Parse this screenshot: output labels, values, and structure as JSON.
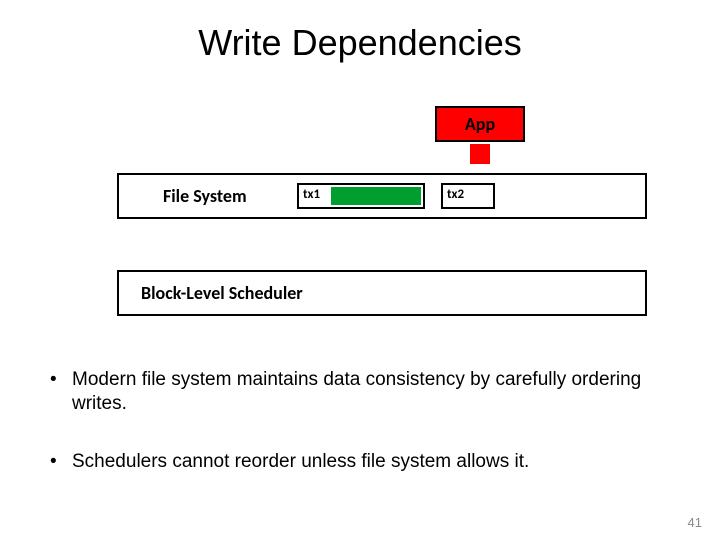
{
  "title": "Write Dependencies",
  "app": {
    "label": "App"
  },
  "filesystem": {
    "label": "File System",
    "tx1": "tx1",
    "tx2": "tx2"
  },
  "scheduler": {
    "label": "Block-Level Scheduler"
  },
  "bullets": {
    "b1": "Modern file system maintains data consistency by carefully ordering writes.",
    "b2": "Schedulers cannot reorder unless file system allows it."
  },
  "slide_number": "41"
}
